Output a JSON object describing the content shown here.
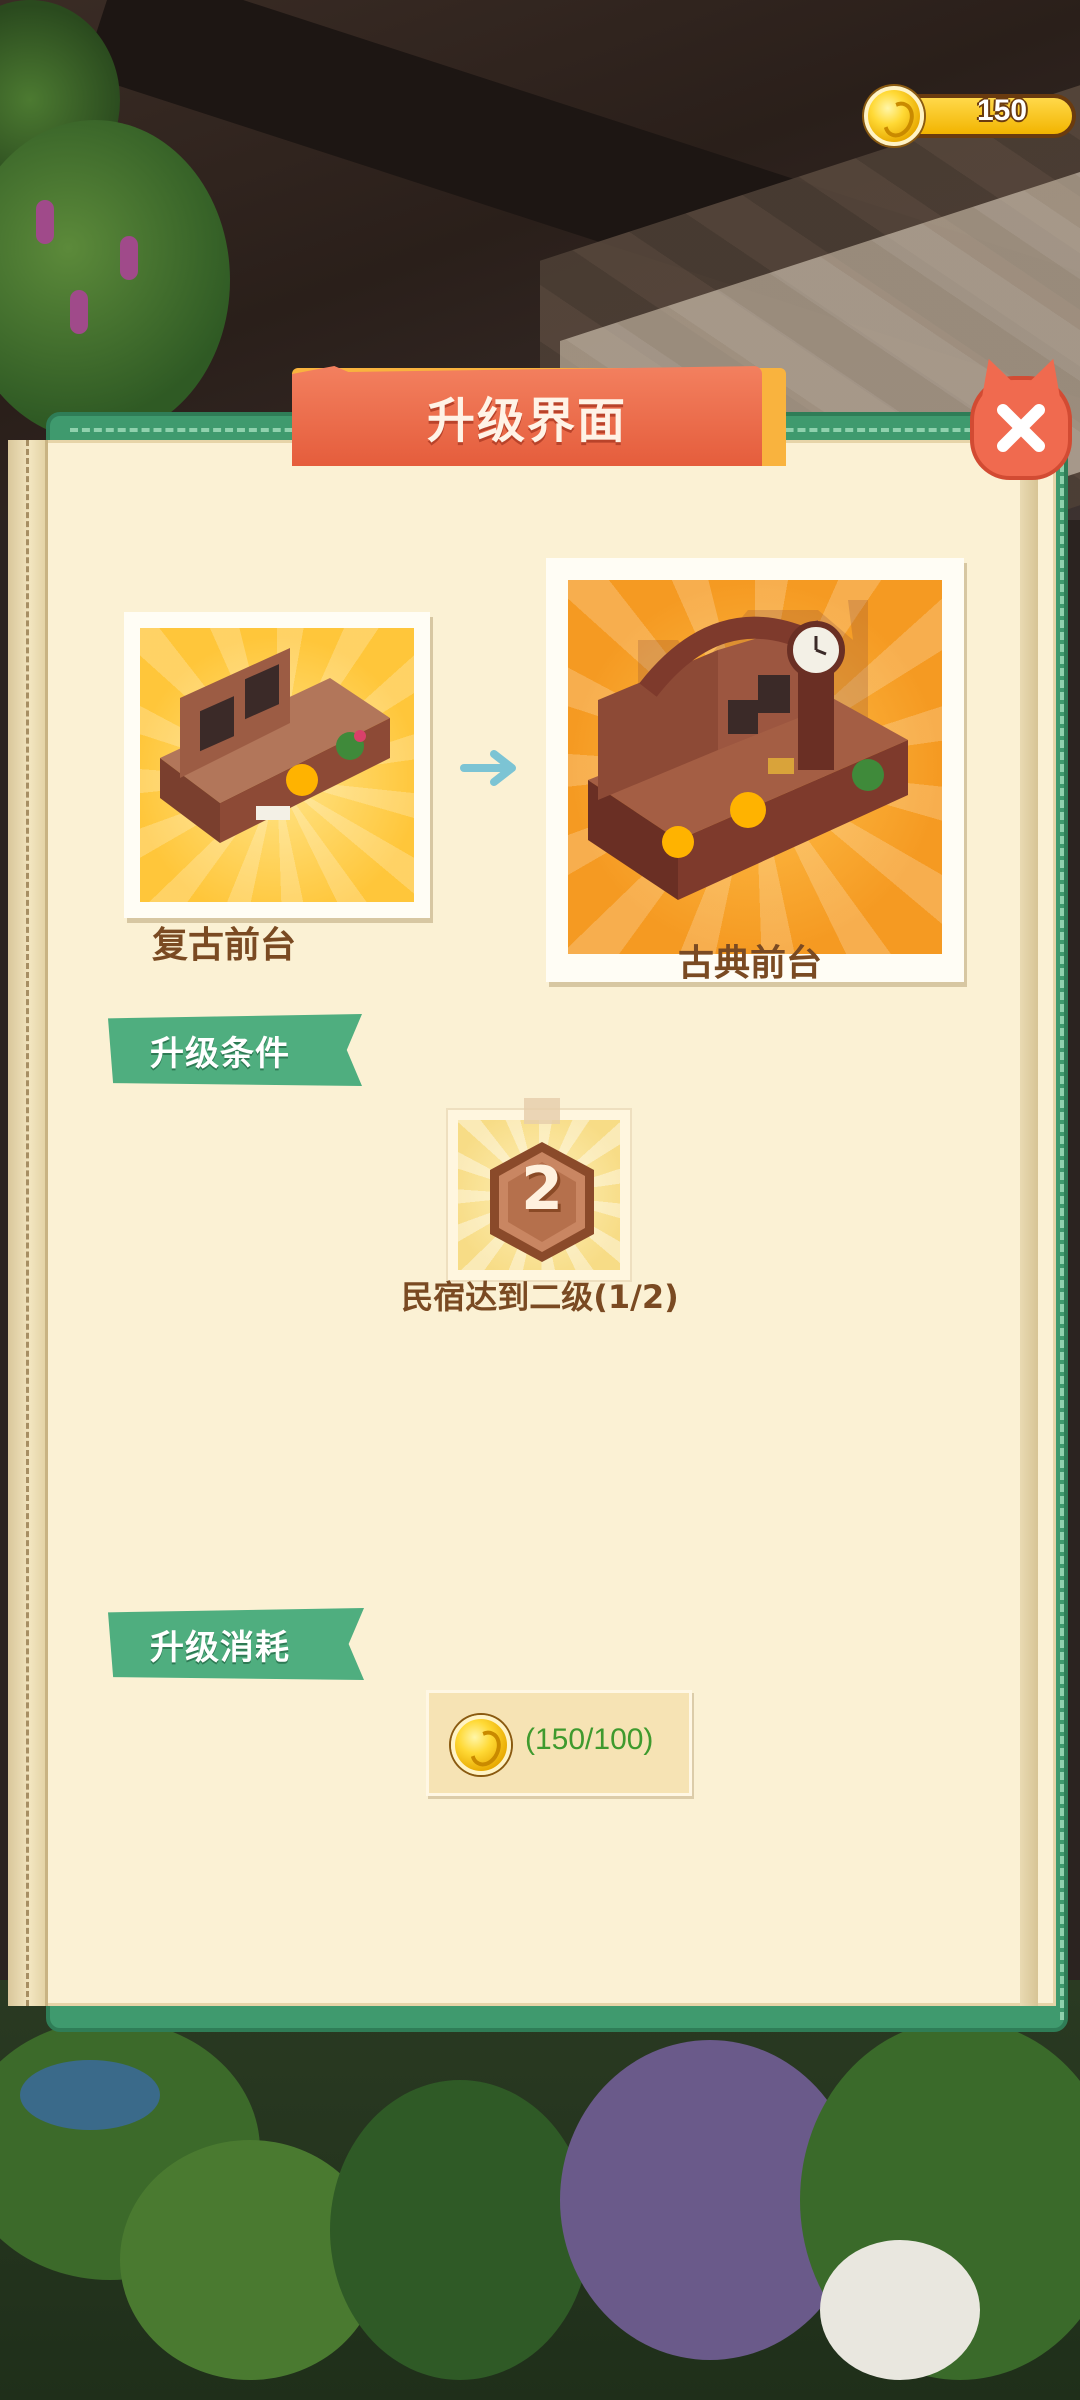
{
  "hud": {
    "coin_count": "150"
  },
  "dialog": {
    "title": "升级界面",
    "close_icon": "close-icon"
  },
  "current_item": {
    "name": "复古前台"
  },
  "next_item": {
    "name": "古典前台"
  },
  "conditions": {
    "section_title": "升级条件",
    "items": [
      {
        "level_badge": "2",
        "label": "民宿达到二级(1/2)"
      }
    ]
  },
  "cost": {
    "section_title": "升级消耗",
    "items": [
      {
        "icon": "coin-icon",
        "value": "(150/100)"
      }
    ]
  },
  "colors": {
    "panel_green": "#3f9a6e",
    "title_red": "#e55d3c",
    "page_cream": "#fbf1d4",
    "label_brown": "#7a4a22",
    "cost_green": "#3f9a2e"
  }
}
